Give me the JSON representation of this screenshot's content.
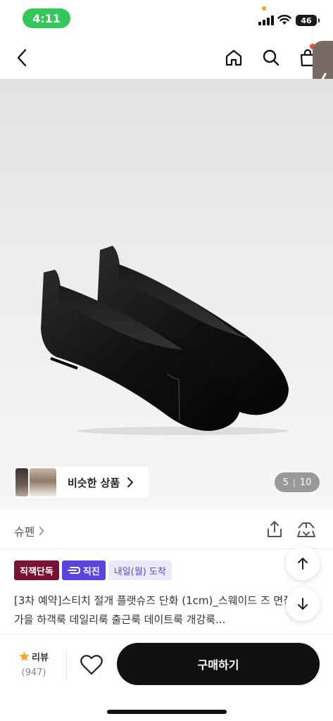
{
  "status_bar": {
    "time": "4:11",
    "battery": "46"
  },
  "nav": {
    "icons": [
      "chevron-left-icon",
      "home-icon",
      "search-icon",
      "cart-icon"
    ]
  },
  "gallery": {
    "similar_label": "비슷한 상품",
    "current_page": "5",
    "total_pages": "10"
  },
  "brand": {
    "name": "슈펜"
  },
  "badges": {
    "exclusive": "직잭단독",
    "direct": "직진",
    "delivery": "내일(월) 도착"
  },
  "product": {
    "title": "[3차 예약]스티치 절개 플랫슈즈 단화 (1cm)_스웨이드 즈 면접구두 가을 하객룩 데일리룩 출근룩 데이트룩 개강룩..."
  },
  "bottom_bar": {
    "review_label": "리뷰",
    "review_count": "(947)",
    "buy_label": "구매하기"
  },
  "colors": {
    "status_green": "#34c759",
    "badge_exclusive": "#7a1236",
    "badge_direct": "#5b43e0",
    "buy_button": "#111111",
    "star": "#f5a623"
  }
}
